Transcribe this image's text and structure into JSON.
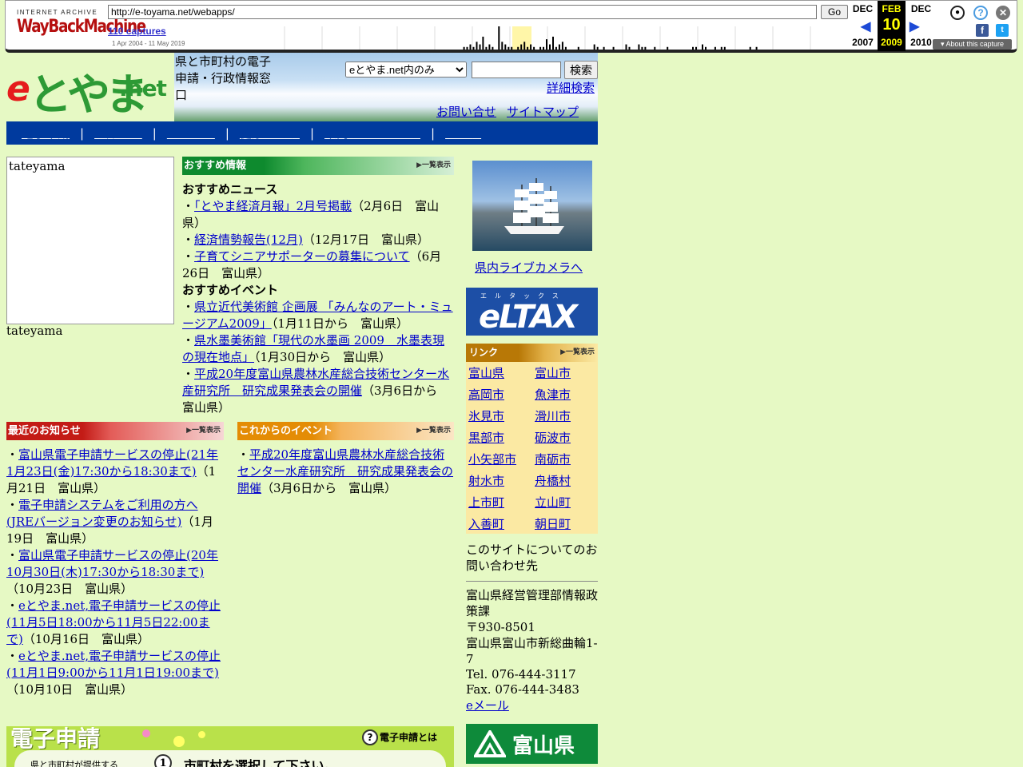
{
  "wayback": {
    "logo_top": "INTERNET ARCHIVE",
    "logo": "WayBackMachine",
    "url": "http://e-toyama.net/webapps/",
    "go": "Go",
    "captures": "110 captures",
    "range": "1 Apr 2004 - 11 May 2019",
    "prev": {
      "month": "DEC",
      "year": "2007"
    },
    "cur": {
      "month": "FEB",
      "day": "10",
      "year": "2009"
    },
    "next": {
      "month": "DEC",
      "year": "2010"
    },
    "about": "About this capture",
    "sparkline": [
      0,
      0,
      0,
      0,
      0,
      0,
      0,
      0,
      0,
      0,
      0,
      0,
      0,
      0,
      0,
      0,
      0,
      0,
      0,
      0,
      0,
      0,
      0,
      0,
      0,
      0,
      0,
      0,
      0,
      0,
      0,
      0,
      0,
      0,
      0,
      0,
      0,
      0,
      0,
      0,
      0,
      0,
      0,
      0,
      0,
      0,
      0,
      0,
      0,
      0,
      0,
      0,
      0,
      0,
      0,
      0,
      0,
      0,
      0,
      0,
      0,
      0,
      0,
      0,
      0,
      0,
      0,
      0,
      1,
      1,
      2,
      1,
      3,
      2,
      5,
      1,
      2,
      1,
      0,
      9,
      3,
      2,
      1,
      1,
      0,
      1,
      2,
      3,
      1,
      2,
      1,
      0,
      1,
      1,
      4,
      2,
      5,
      1,
      2,
      3,
      1,
      0,
      0,
      0,
      1,
      0,
      0,
      0,
      0,
      2,
      1,
      0,
      1,
      0,
      0,
      1,
      0,
      0,
      0,
      2,
      1,
      0,
      0,
      2,
      1,
      1,
      0,
      0,
      1,
      0,
      0,
      0,
      1,
      0,
      0,
      0,
      0,
      0,
      0,
      0,
      1,
      1,
      0,
      2,
      1,
      0,
      0,
      1,
      0,
      1,
      1,
      0,
      0,
      0,
      0,
      0,
      0,
      0,
      1,
      0,
      1,
      0,
      0,
      0,
      0,
      0,
      0,
      0,
      0,
      0,
      0,
      0,
      0,
      0,
      0,
      0,
      0,
      0,
      0,
      0,
      0,
      0,
      0,
      0,
      0,
      0,
      0,
      0,
      0
    ]
  },
  "site": {
    "logo_e": "e",
    "logo_toyama": "とやま",
    "logo_net": ".net",
    "tagline": "県と市町村の電子申請・行政情報窓口",
    "search_option": "eとやま.net内のみ",
    "search_button": "検索",
    "advanced": "詳細検索",
    "contact": "お問い合せ",
    "sitemap": "サイトマップ",
    "nav": [
      "電子申請",
      "お知らせ",
      "イベント",
      "健康づくり",
      "県内ライブカメラ",
      "リンク"
    ]
  },
  "photo": {
    "alt": "tateyama",
    "caption": "tateyama"
  },
  "recommend": {
    "banner": "おすすめ情報",
    "more": "▶一覧表示",
    "news_title": "おすすめニュース",
    "news": [
      {
        "link": "「とやま経済月報」2月号掲載",
        "meta": "（2月6日　富山県）"
      },
      {
        "link": "経済情勢報告(12月)",
        "meta": "（12月17日　富山県）"
      },
      {
        "link": "子育てシニアサポーターの募集について",
        "meta": "（6月26日　富山県）"
      }
    ],
    "events_title": "おすすめイベント",
    "events": [
      {
        "link": "県立近代美術館 企画展 「みんなのアート・ミュージアム2009」",
        "meta": "（1月11日から　富山県）"
      },
      {
        "link": "県水墨美術館「現代の水墨画 2009　水墨表現の現在地点」",
        "meta": "（1月30日から　富山県）"
      },
      {
        "link": "平成20年度富山県農林水産総合技術センター水産研究所　研究成果発表会の開催",
        "meta": "（3月6日から　富山県）"
      }
    ]
  },
  "news": {
    "banner": "最近のお知らせ",
    "more": "▶一覧表示",
    "items": [
      {
        "link": "富山県電子申請サービスの停止(21年1月23日(金)17:30から18:30まで)",
        "meta": "（1月21日　富山県）"
      },
      {
        "link": "電子申請システムをご利用の方へ(JREバージョン変更のお知らせ)",
        "meta": "（1月19日　富山県）"
      },
      {
        "link": "富山県電子申請サービスの停止(20年10月30日(木)17:30から18:30まで)",
        "meta": "（10月23日　富山県）"
      },
      {
        "link": "eとやま.net,電子申請サービスの停止(11月5日18:00から11月5日22:00まで)",
        "meta": "（10月16日　富山県）"
      },
      {
        "link": "eとやま.net,電子申請サービスの停止(11月1日9:00から11月1日19:00まで)",
        "meta": "（10月10日　富山県）"
      }
    ]
  },
  "events": {
    "banner": "これからのイベント",
    "more": "▶一覧表示",
    "items": [
      {
        "link": "平成20年度富山県農林水産総合技術センター水産研究所　研究成果発表会の開催",
        "meta": "（3月6日から　富山県）"
      }
    ]
  },
  "denshi": {
    "title": "電子申請",
    "what": "電子申請とは",
    "qmark": "?",
    "sub": "県と市町村が提供する",
    "num": "1",
    "select": "市町村を選択して下さい。"
  },
  "right": {
    "camera_link": "県内ライブカメラへ",
    "eltax_kana": "エルタックス",
    "eltax": "eLTAX",
    "links_title": "リンク",
    "links_more": "▶一覧表示",
    "links": [
      "富山県",
      "富山市",
      "高岡市",
      "魚津市",
      "氷見市",
      "滑川市",
      "黒部市",
      "砺波市",
      "小矢部市",
      "南砺市",
      "射水市",
      "舟橋村",
      "上市町",
      "立山町",
      "入善町",
      "朝日町"
    ],
    "contact_title": "このサイトについてのお問い合わせ先",
    "dept": "富山県経営管理部情報政策課",
    "zip": "〒930-8501",
    "address": "富山県富山市新総曲輪1-7",
    "tel": "Tel. 076-444-3117",
    "fax": "Fax. 076-444-3483",
    "email": "eメール",
    "toyama_badge": "富山県"
  },
  "colors": {
    "nav": "#003a9e",
    "rec": "#0e8a2e",
    "news": "#c31b16",
    "events": "#e48c05",
    "links_bg": "#fbe9a3",
    "page_bg": "#e6f9c4"
  }
}
